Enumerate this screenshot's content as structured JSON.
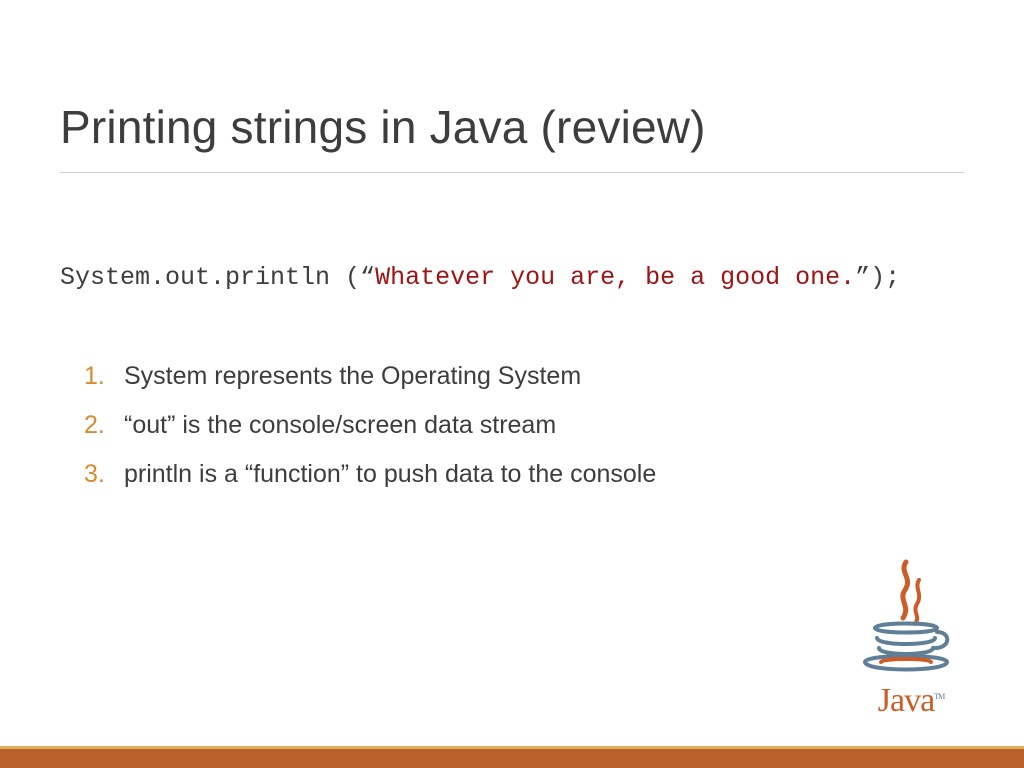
{
  "title": "Printing strings in Java (review)",
  "code": {
    "prefix": "System.out.println (“",
    "string": "Whatever you are, be a good one.",
    "suffix": "”);"
  },
  "items": [
    "System represents the Operating System",
    "“out” is the console/screen data stream",
    "println is a “function” to push data to the console"
  ],
  "logo": {
    "text": "Java",
    "tm": "TM"
  }
}
